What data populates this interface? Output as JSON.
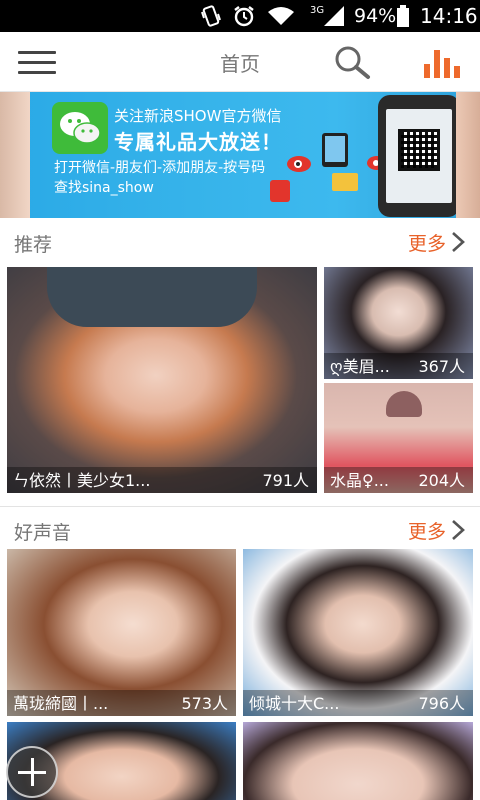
{
  "status_bar": {
    "network": "3G",
    "battery": "94%",
    "time": "14:16"
  },
  "header": {
    "title": "首页"
  },
  "banner": {
    "line1": "关注新浪SHOW官方微信",
    "line2": "专属礼品大放送！",
    "line3": "打开微信-朋友们-添加朋友-按号码",
    "line4": "查找sina_show"
  },
  "sections": [
    {
      "title": "推荐",
      "more_label": "更多",
      "tiles": [
        {
          "name": "ㄣ依然丨美少女1...",
          "count": "791人"
        },
        {
          "name": "ღ美眉...",
          "count": "367人"
        },
        {
          "name": "水晶♀...",
          "count": "204人"
        }
      ]
    },
    {
      "title": "好声音",
      "more_label": "更多",
      "tiles": [
        {
          "name": "萬珑締國丨...",
          "count": "573人"
        },
        {
          "name": "倾城十大C...",
          "count": "796人"
        },
        {
          "name": "",
          "count": ""
        },
        {
          "name": "",
          "count": ""
        }
      ]
    }
  ],
  "colors": {
    "accent": "#e8622a",
    "banner_blue": "#36b3ea"
  }
}
